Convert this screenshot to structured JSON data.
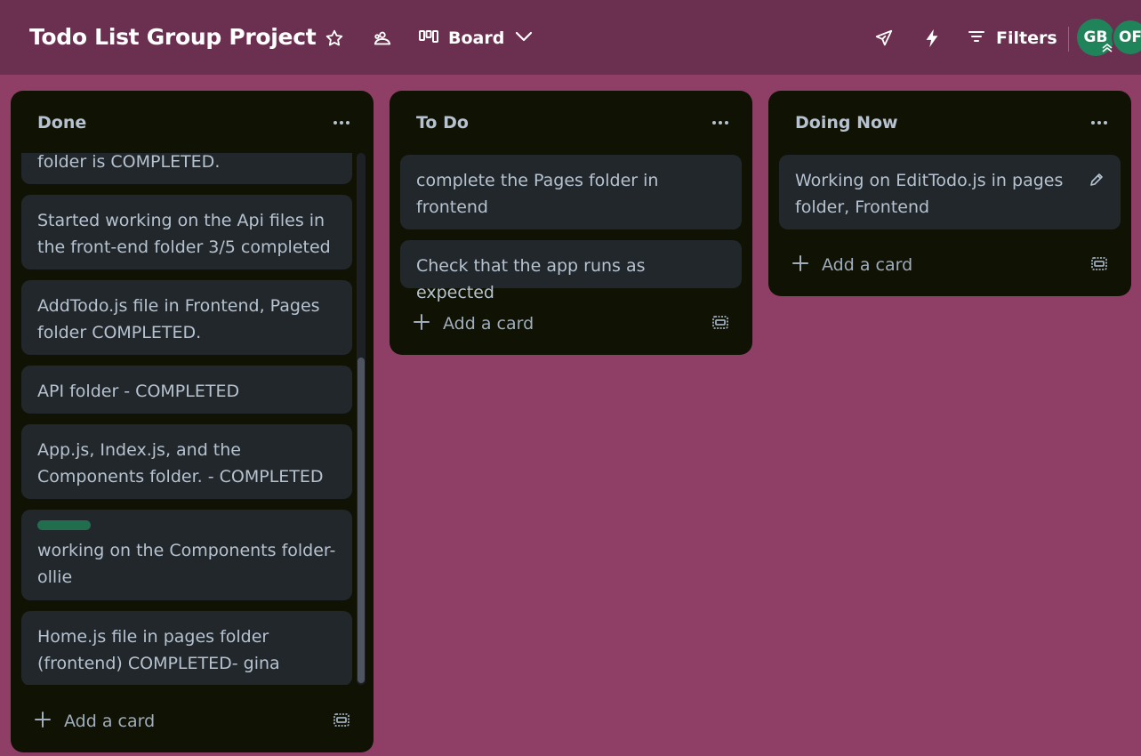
{
  "header": {
    "board_title": "Todo List Group Project",
    "view_label": "Board",
    "filters_label": "Filters",
    "members": [
      {
        "initials": "GB"
      },
      {
        "initials": "OF"
      }
    ]
  },
  "lists": [
    {
      "title": "Done",
      "cards": [
        {
          "text": "folder is COMPLETED."
        },
        {
          "text": "Started working on the Api files in the front-end folder 3/5 completed"
        },
        {
          "text": "AddTodo.js file in Frontend, Pages folder COMPLETED."
        },
        {
          "text": "API folder - COMPLETED"
        },
        {
          "text": "App.js, Index.js, and the Components folder. - COMPLETED"
        },
        {
          "text": "working on the Components folder- ollie",
          "label_color": "#216e4e"
        },
        {
          "text": "Home.js file in pages folder (frontend) COMPLETED- gina"
        }
      ],
      "add_card_label": "Add a card"
    },
    {
      "title": "To Do",
      "cards": [
        {
          "text": "complete the Pages folder in frontend"
        },
        {
          "text": "Check that the app runs as expected"
        }
      ],
      "add_card_label": "Add a card"
    },
    {
      "title": "Doing Now",
      "cards": [
        {
          "text": "Working on EditTodo.js in pages folder, Frontend"
        }
      ],
      "add_card_label": "Add a card"
    }
  ],
  "colors": {
    "background": "#8f3f66",
    "header": "#6b3050",
    "list": "#101204",
    "card": "#22272b",
    "avatar": "#1f845a"
  }
}
